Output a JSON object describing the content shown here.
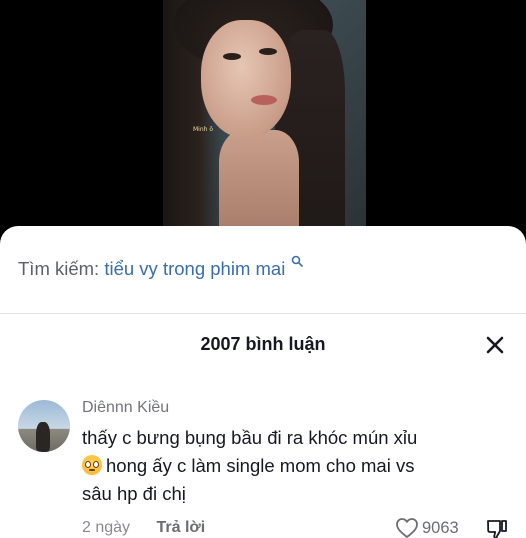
{
  "video": {
    "watermark": "Minh ô"
  },
  "search": {
    "label": "Tìm kiếm:",
    "query": "tiểu vy trong phim mai"
  },
  "comments_header": {
    "title": "2007 bình luận"
  },
  "comment": {
    "username": "Diênnn Kiều",
    "text_line1": "thấy c bưng bụng bầu đi ra khóc mún xỉu",
    "text_line2": "hong ấy c làm single mom cho mai vs",
    "text_line3": "sâu hp đi chị",
    "emoji": "pleading-face",
    "time": "2 ngày",
    "reply_label": "Trả lời",
    "likes": "9063"
  },
  "colors": {
    "link": "#3a6ea8",
    "text": "#161823",
    "muted": "#73757a"
  }
}
